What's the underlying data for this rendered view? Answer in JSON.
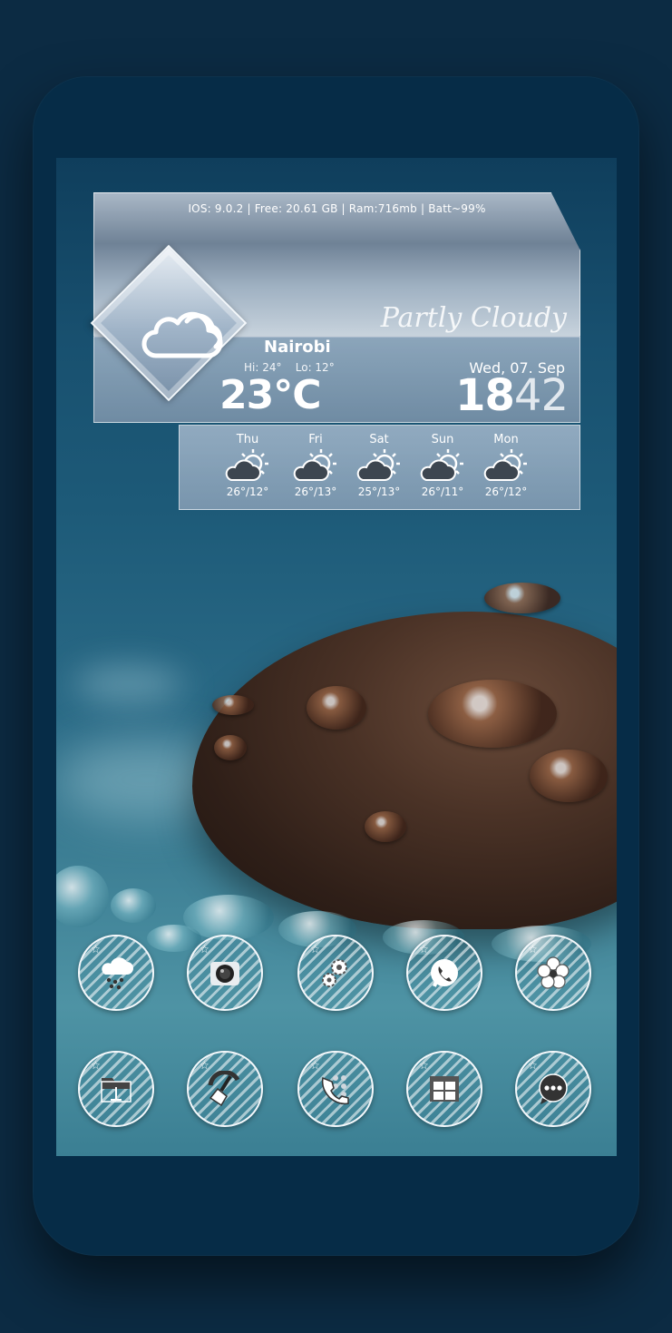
{
  "weather": {
    "system_info": "IOS: 9.0.2 | Free: 20.61 GB | Ram:716mb | Batt~99%",
    "condition": "Partly Cloudy",
    "city": "Nairobi",
    "hi": "Hi: 24°",
    "lo": "Lo: 12°",
    "temperature": "23°C",
    "date": "Wed, 07. Sep",
    "time_hours": "18",
    "time_minutes": "42",
    "icon": "cloud-icon",
    "forecast": [
      {
        "day": "Thu",
        "temps": "26°/12°",
        "icon": "partly-cloudy-icon"
      },
      {
        "day": "Fri",
        "temps": "26°/13°",
        "icon": "partly-cloudy-icon"
      },
      {
        "day": "Sat",
        "temps": "25°/13°",
        "icon": "partly-cloudy-icon"
      },
      {
        "day": "Sun",
        "temps": "26°/11°",
        "icon": "partly-cloudy-icon"
      },
      {
        "day": "Mon",
        "temps": "26°/12°",
        "icon": "partly-cloudy-icon"
      }
    ]
  },
  "apps": [
    {
      "icon": "weather-rain-icon"
    },
    {
      "icon": "camera-icon"
    },
    {
      "icon": "settings-gears-icon"
    },
    {
      "icon": "whatsapp-icon"
    },
    {
      "icon": "flower-icon"
    },
    {
      "icon": "file-manager-icon"
    },
    {
      "icon": "cleaner-broom-icon"
    },
    {
      "icon": "phone-dialer-icon"
    },
    {
      "icon": "windows-grid-icon"
    },
    {
      "icon": "chat-bubble-icon"
    }
  ],
  "colors": {
    "frame": "#062c47",
    "background": "#0c2b43",
    "widget_text": "#ffffff"
  }
}
